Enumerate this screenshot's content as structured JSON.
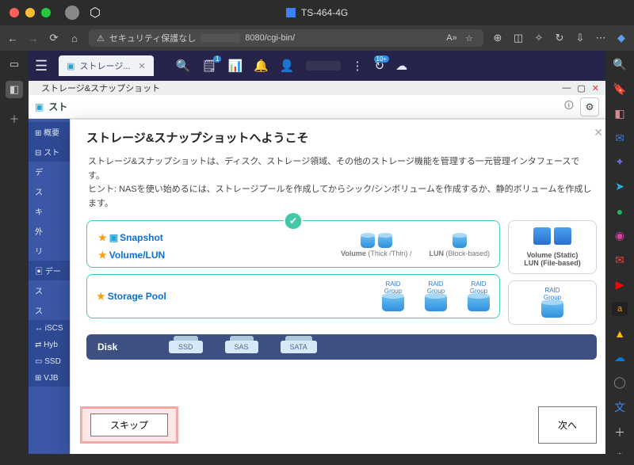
{
  "window": {
    "title": "TS-464-4G"
  },
  "browser": {
    "security_label": "セキュリティ保護なし",
    "url_suffix": "8080/cgi-bin/"
  },
  "qts": {
    "tab_label": "ストレージ...",
    "clipboard_badge": "1",
    "refresh_badge": "10+"
  },
  "app": {
    "breadcrumb": "ストレージ&スナップショット",
    "header_title": "スト",
    "sidebar": {
      "items": [
        {
          "icon": "⊞",
          "label": "概要"
        },
        {
          "icon": "⊟",
          "label": "スト"
        },
        {
          "icon": "",
          "label": "デ"
        },
        {
          "icon": "",
          "label": "ス"
        },
        {
          "icon": "",
          "label": "キ"
        },
        {
          "icon": "",
          "label": "外"
        },
        {
          "icon": "",
          "label": "リ"
        },
        {
          "icon": "▣",
          "label": "デー"
        },
        {
          "icon": "",
          "label": "ス"
        },
        {
          "icon": "",
          "label": "ス"
        },
        {
          "icon": "↔",
          "label": "iSCS"
        },
        {
          "icon": "⇄",
          "label": "Hyb"
        },
        {
          "icon": "▭",
          "label": "SSD"
        },
        {
          "icon": "⊞",
          "label": "VJB"
        }
      ]
    }
  },
  "modal": {
    "title": "ストレージ&スナップショットへようこそ",
    "desc_line1": "ストレージ&スナップショットは、ディスク、ストレージ領域、その他のストレージ機能を管理する一元管理インタフェースです。",
    "desc_line2": "ヒント: NASを使い始めるには、ストレージプールを作成してからシック/シンボリュームを作成するか、静的ボリュームを作成します。",
    "snapshot_label": "Snapshot",
    "volumelun_label": "Volume/LUN",
    "volume_caption_pre": "Volume",
    "volume_caption_paren": "(Thick /Thin)",
    "lun_caption_pre": "LUN",
    "lun_caption_paren": "(Block-based)",
    "static_vol": "Volume (Static)",
    "static_lun": "LUN (File-based)",
    "storage_pool_label": "Storage Pool",
    "raid_label_1": "RAID",
    "raid_label_2": "Group",
    "disk_label": "Disk",
    "disk_types": [
      "SSD",
      "SAS",
      "SATA"
    ],
    "skip_label": "スキップ",
    "next_label": "次へ"
  },
  "colors": {
    "qts_nav": "#26244b",
    "accent": "#47c4c4",
    "sidebar": "#3b57a6",
    "highlight_border": "#f7a7a7"
  }
}
